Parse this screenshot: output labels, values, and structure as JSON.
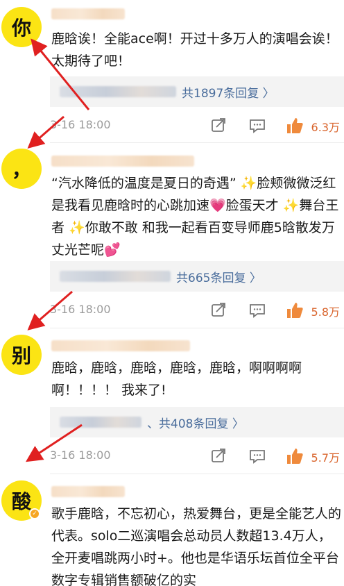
{
  "comments": [
    {
      "avatar_char": "你",
      "text": "鹿晗诶！全能ace啊！开过十多万人的演唱会诶！太期待了吧！",
      "reply_link": "共1897条回复 〉",
      "time": "3-16 18:00",
      "likes": "6.3万"
    },
    {
      "avatar_char": "，",
      "text": "“汽水降低的温度是夏日的奇遇” ✨脸颊微微泛红是我看见鹿晗时的心跳加速💗脸蛋天才 ✨舞台王者 ✨你敢不敢 和我一起看百变导师鹿5晗散发万丈光芒呢💕",
      "reply_link": "共665条回复 〉",
      "time": "3-16 18:00",
      "likes": "5.8万"
    },
    {
      "avatar_char": "别",
      "text": "鹿晗，鹿晗，鹿晗，鹿晗，鹿晗，啊啊啊啊啊！！！！ 我来了!",
      "reply_link": "、共408条回复 〉",
      "time": "3-16 18:00",
      "likes": "5.7万"
    },
    {
      "avatar_char": "酸",
      "text": "歌手鹿晗，不忘初心，热爱舞台，更是全能艺人的代表。solo二巡演唱会总动员人数超13.4万人，全开麦唱跳两小时+。他也是华语乐坛首位全平台数字专辑销售额破亿的实"
    }
  ],
  "icons": {
    "share": "share-icon",
    "comment": "comment-icon",
    "like": "thumbs-up-icon",
    "verified": "verified-badge-icon"
  },
  "colors": {
    "avatar_bg": "#fbe414",
    "reply_link": "#4a6d9c",
    "likes": "#d9642c",
    "arrows": "#e02020"
  }
}
